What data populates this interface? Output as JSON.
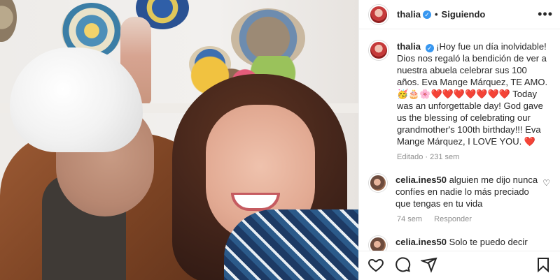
{
  "header": {
    "username": "thalia",
    "following_label": "Siguiendo",
    "more_icon": "more-horizontal-icon"
  },
  "caption": {
    "username": "thalia",
    "text_es": "¡Hoy fue un día inolvidable! Dios nos regaló la bendición de ver a nuestra abuela celebrar sus 100 años. Eva Mange Márquez, TE AMO.",
    "emoji_line": "🥳🎂🌸❤️❤️❤️❤️❤️❤️❤️",
    "text_en": "Today was an unforgettable day! God gave us the blessing of celebrating our grandmother's 100th birthday!!! Eva Mange Márquez, I LOVE YOU.",
    "heart_end": "❤️",
    "meta": "Editado · 231 sem"
  },
  "comments": [
    {
      "username": "celia.ines50",
      "text": "alguien me dijo nunca confíes en nadie lo más preciado que tengas en tu vida",
      "time": "74 sem",
      "reply_label": "Responder"
    },
    {
      "username": "celia.ines50",
      "text": "Solo te puedo decir que"
    }
  ],
  "icons": {
    "like": "heart-icon",
    "comment": "comment-icon",
    "share": "share-icon",
    "save": "bookmark-icon"
  }
}
